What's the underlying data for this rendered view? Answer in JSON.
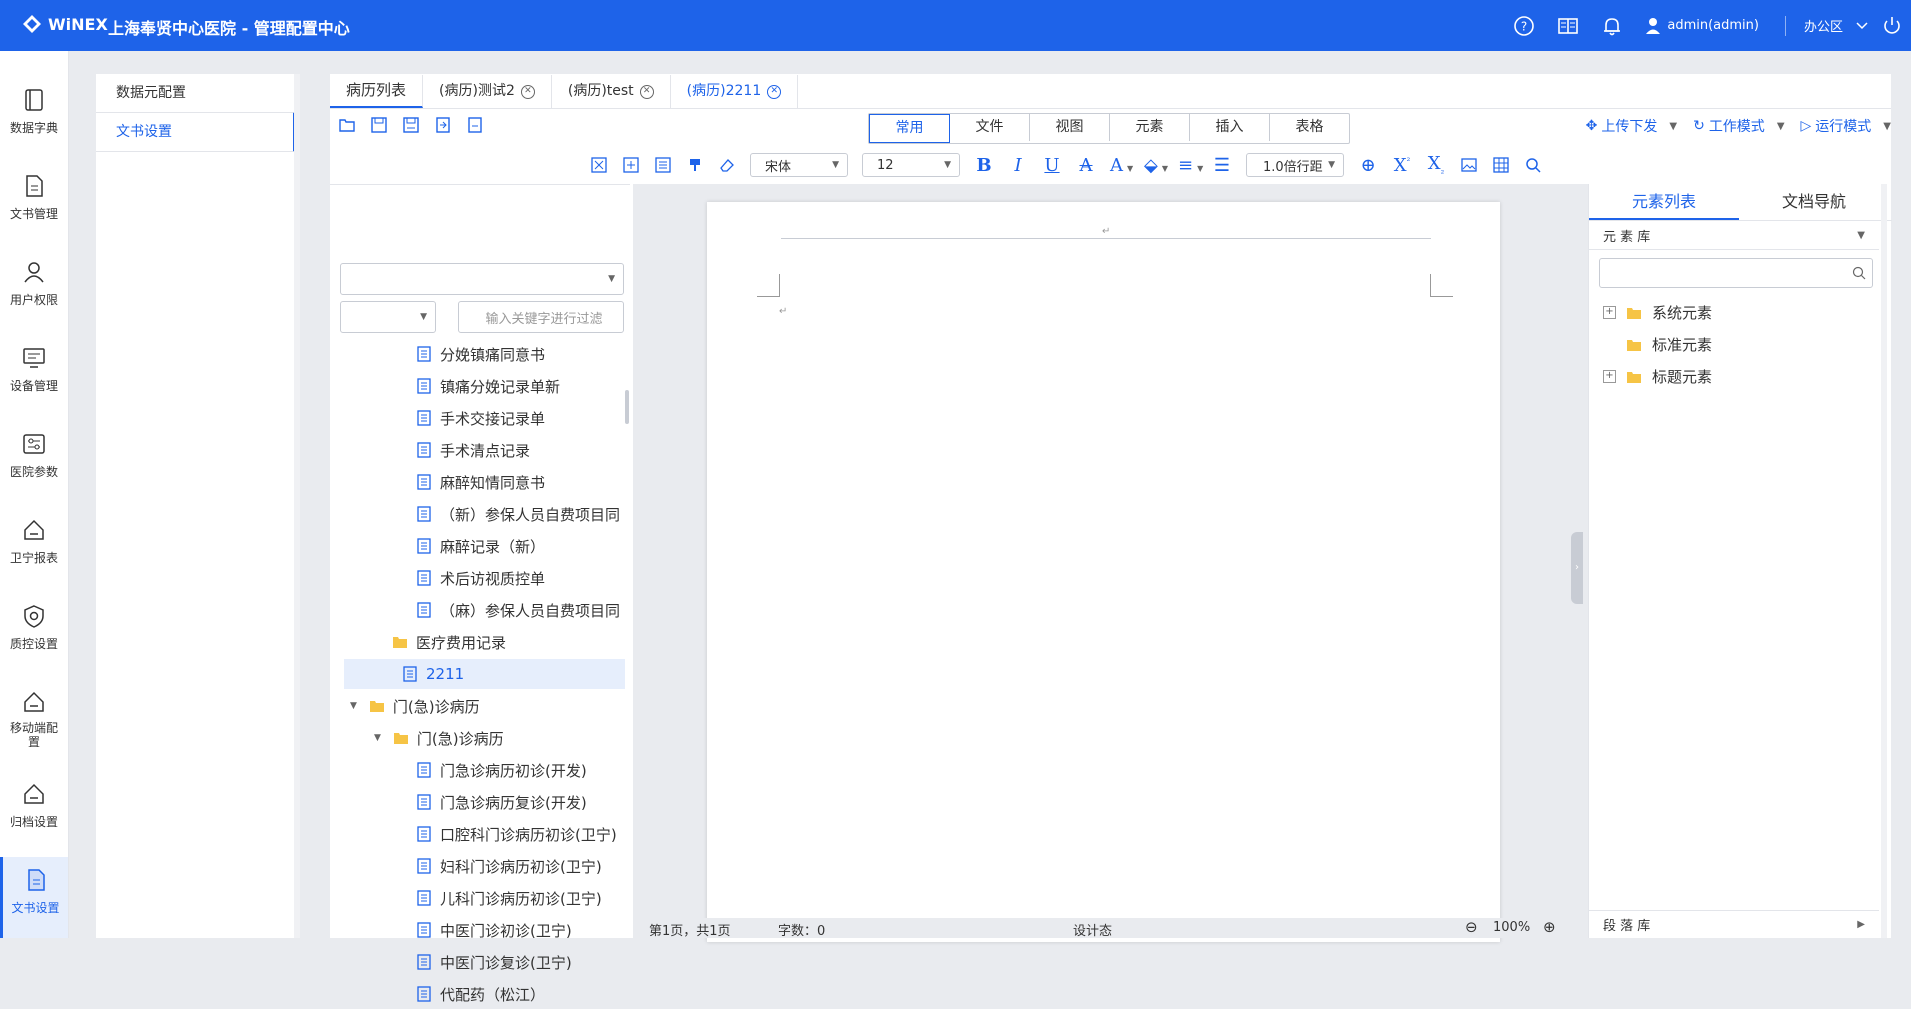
{
  "header": {
    "logo_text": "WiNEX",
    "title": "上海奉贤中心医院 - 管理配置中心",
    "user": "admin(admin)",
    "zone": "办公区"
  },
  "sidebar": {
    "items": [
      {
        "label": "数据字典",
        "icon": "book-icon"
      },
      {
        "label": "文书管理",
        "icon": "document-icon"
      },
      {
        "label": "用户权限",
        "icon": "user-icon"
      },
      {
        "label": "设备管理",
        "icon": "monitor-icon"
      },
      {
        "label": "医院参数",
        "icon": "settings-panel-icon"
      },
      {
        "label": "卫宁报表",
        "icon": "report-icon"
      },
      {
        "label": "质控设置",
        "icon": "shield-icon"
      },
      {
        "label": "移动端配置",
        "icon": "mobile-icon"
      },
      {
        "label": "归档设置",
        "icon": "archive-icon"
      },
      {
        "label": "文书设置",
        "icon": "document-settings-icon"
      }
    ]
  },
  "subnav": {
    "items": [
      "数据元配置",
      "文书设置"
    ]
  },
  "tabs": [
    {
      "label": "病历列表"
    },
    {
      "label": "(病历)测试2"
    },
    {
      "label": "(病历)test"
    },
    {
      "label": "(病历)2211"
    }
  ],
  "ribbon": [
    "常用",
    "文件",
    "视图",
    "元素",
    "插入",
    "表格"
  ],
  "modes": [
    "上传下发",
    "工作模式",
    "运行模式"
  ],
  "format": {
    "font": "宋体",
    "size": "12",
    "line_spacing": "1.0倍行距"
  },
  "tree": {
    "filter_placeholder": "输入关键字进行过滤",
    "nodes": [
      {
        "label": "分娩镇痛同意书",
        "type": "doc"
      },
      {
        "label": "镇痛分娩记录单新",
        "type": "doc"
      },
      {
        "label": "手术交接记录单",
        "type": "doc"
      },
      {
        "label": "手术清点记录",
        "type": "doc"
      },
      {
        "label": "麻醉知情同意书",
        "type": "doc"
      },
      {
        "label": "（新）参保人员自费项目同",
        "type": "doc"
      },
      {
        "label": "麻醉记录（新）",
        "type": "doc"
      },
      {
        "label": "术后访视质控单",
        "type": "doc"
      },
      {
        "label": "（麻）参保人员自费项目同",
        "type": "doc"
      },
      {
        "label": "医疗费用记录",
        "type": "folder"
      },
      {
        "label": "2211",
        "type": "doc"
      },
      {
        "label": "门(急)诊病历",
        "type": "folder"
      },
      {
        "label": "门(急)诊病历",
        "type": "folder"
      },
      {
        "label": "门急诊病历初诊(开发)",
        "type": "doc"
      },
      {
        "label": "门急诊病历复诊(开发)",
        "type": "doc"
      },
      {
        "label": "口腔科门诊病历初诊(卫宁)",
        "type": "doc"
      },
      {
        "label": "妇科门诊病历初诊(卫宁)",
        "type": "doc"
      },
      {
        "label": "儿科门诊病历初诊(卫宁)",
        "type": "doc"
      },
      {
        "label": "中医门诊初诊(卫宁)",
        "type": "doc"
      },
      {
        "label": "中医门诊复诊(卫宁)",
        "type": "doc"
      },
      {
        "label": "代配药（松江）",
        "type": "doc"
      }
    ]
  },
  "status": {
    "page": "第1页，共1页",
    "words": "字数：0",
    "mode": "设计态",
    "zoom": "100%"
  },
  "right_panel": {
    "tabs": [
      "元素列表",
      "文档导航"
    ],
    "library": "元 素 库",
    "nodes": [
      "系统元素",
      "标准元素",
      "标题元素"
    ],
    "paragraph_library": "段 落 库"
  },
  "colors": {
    "brand": "#1e63e9"
  }
}
